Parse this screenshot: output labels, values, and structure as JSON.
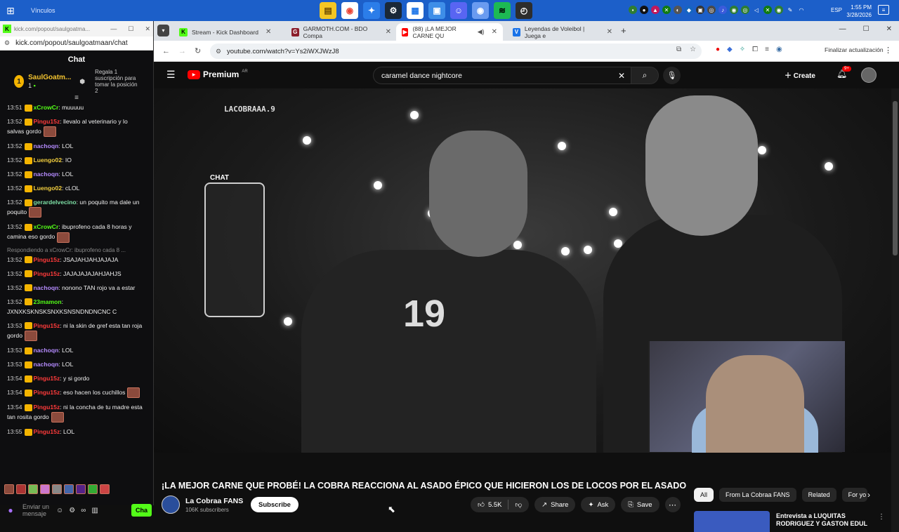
{
  "taskbar": {
    "label": "Vínculos",
    "lang": "ESP",
    "time": "1:55 PM",
    "date": "3/28/2026",
    "apps": [
      "file-explorer-icon",
      "chrome-icon",
      "copilot-icon",
      "steam-icon",
      "store-icon",
      "photos-icon",
      "discord-icon",
      "chrome-2-icon",
      "spotify-icon",
      "clock-icon"
    ]
  },
  "popup": {
    "tab_url": "kick.com/popout/saulgoatma...",
    "url": "kick.com/popout/saulgoatmaan/chat",
    "title": "Chat",
    "pinned_user": "SaulGoatm...",
    "pinned_count": "1",
    "pinned_note": "Regala 1 suscripción para tomar la posición 2",
    "reply_note": "Respondiendo a xCrowCr: ibuprofeno cada 8 ...",
    "input_placeholder": "Enviar un mensaje",
    "chat_button": "Cha"
  },
  "messages": [
    {
      "time": "13:51",
      "user": "xCrowCr",
      "color": "#53fc18",
      "text": ": muuuuu"
    },
    {
      "time": "13:52",
      "user": "Pingu15z",
      "color": "#ff3b3b",
      "text": ": llevalo al veterinario y lo salvas gordo"
    },
    {
      "time": "13:52",
      "user": "nachoqn",
      "color": "#b58bff",
      "text": ": LOL"
    },
    {
      "time": "13:52",
      "user": "Luengo02",
      "color": "#f4d03f",
      "text": ": IO"
    },
    {
      "time": "13:52",
      "user": "nachoqn",
      "color": "#b58bff",
      "text": ": LOL"
    },
    {
      "time": "13:52",
      "user": "Luengo02",
      "color": "#f4d03f",
      "text": ": cLOL"
    },
    {
      "time": "13:52",
      "user": "gerardelvecino",
      "color": "#7ee0a6",
      "text": ": un poquito ma dale un poquito"
    },
    {
      "time": "13:52",
      "user": "xCrowCr",
      "color": "#53fc18",
      "text": ": ibuprofeno cada 8 horas y camina eso gordo"
    },
    {
      "time": "13:52",
      "user": "Pingu15z",
      "color": "#ff3b3b",
      "text": ": JSAJAHJAHJAJAJA"
    },
    {
      "time": "13:52",
      "user": "Pingu15z",
      "color": "#ff3b3b",
      "text": ": JAJAJAJAJAHJAHJS"
    },
    {
      "time": "13:52",
      "user": "nachoqn",
      "color": "#b58bff",
      "text": ": nonono TAN rojo va a estar"
    },
    {
      "time": "13:52",
      "user": "23mamon",
      "color": "#53fc18",
      "text": ": JXNXKSKNSKSNXKSNSNDNDNCNC C"
    },
    {
      "time": "13:53",
      "user": "Pingu15z",
      "color": "#ff3b3b",
      "text": ": ni la skin de gref esta tan roja gordo"
    },
    {
      "time": "13:53",
      "user": "nachoqn",
      "color": "#b58bff",
      "text": ": LOL"
    },
    {
      "time": "13:53",
      "user": "nachoqn",
      "color": "#b58bff",
      "text": ": LOL"
    },
    {
      "time": "13:54",
      "user": "Pingu15z",
      "color": "#ff3b3b",
      "text": ": y si gordo"
    },
    {
      "time": "13:54",
      "user": "Pingu15z",
      "color": "#ff3b3b",
      "text": ": eso hacen los cuchillos"
    },
    {
      "time": "13:54",
      "user": "Pingu15z",
      "color": "#ff3b3b",
      "text": ": ni la concha de tu madre esta tan rosita gordo"
    },
    {
      "time": "13:55",
      "user": "Pingu15z",
      "color": "#ff3b3b",
      "text": ": LOL"
    }
  ],
  "browser": {
    "tabs": [
      {
        "label": "Stream - Kick Dashboard",
        "fav_color": "#53fc18"
      },
      {
        "label": "GARMOTH.COM - BDO Compa",
        "fav_color": "#8b1e2b"
      },
      {
        "label": "(88) ¡LA MEJOR CARNE QU",
        "fav_color": "#ff0000"
      },
      {
        "label": "Leyendas de Voleibol | Juega e",
        "fav_color": "#1a73e8"
      }
    ],
    "url": "youtube.com/watch?v=Ys2iWXJWzJ8",
    "update_label": "Finalizar actualización"
  },
  "youtube": {
    "logo": "Premium",
    "country": "AR",
    "search_value": "caramel dance nightcore",
    "create_label": "Create",
    "notif_count": "9+",
    "watermark": "LACOBRAAA.9",
    "chat_overlay_label": "CHAT",
    "jersey_number": "19",
    "title": "¡LA MEJOR CARNE QUE PROBÉ! LA COBRA REACCIONA AL ASADO ÉPICO QUE HICIERON LOS DE LOCOS POR EL ASADO",
    "channel": "La Cobraa FANS",
    "subscribers": "106K subscribers",
    "subscribe_label": "Subscribe",
    "likes": "5.5K",
    "share_label": "Share",
    "ask_label": "Ask",
    "save_label": "Save",
    "chips": [
      "All",
      "From La Cobraa FANS",
      "Related",
      "For yo"
    ],
    "rec_title": "Entrevista a LUQUITAS RODRIGUEZ Y GASTON EDUL"
  }
}
